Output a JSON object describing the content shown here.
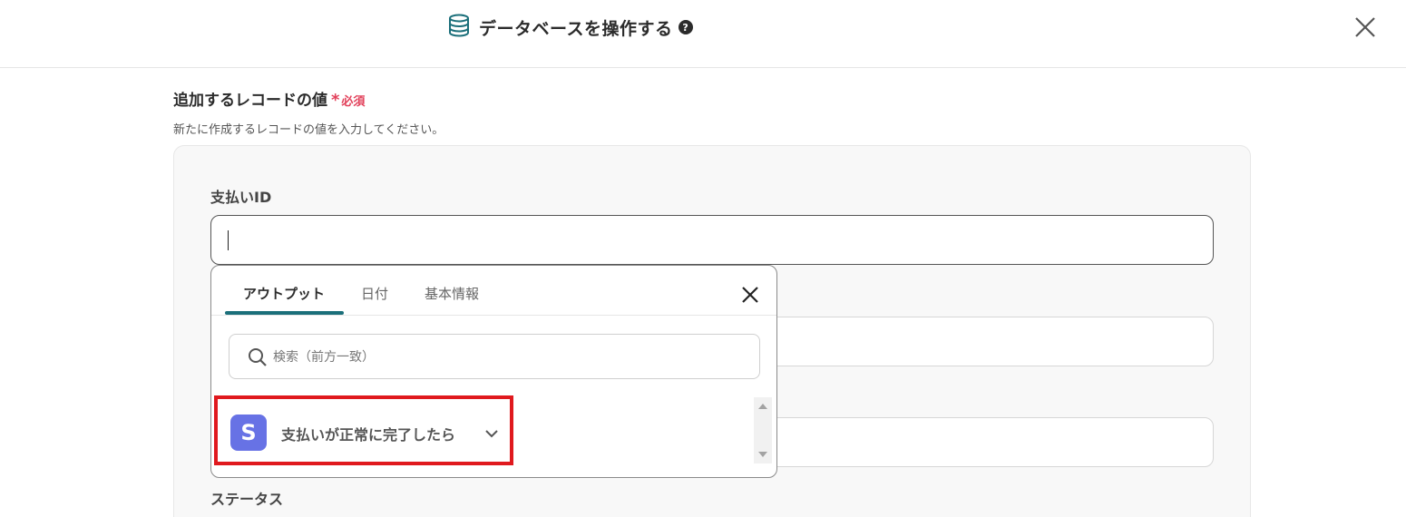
{
  "header": {
    "title": "データベースを操作する",
    "help_symbol": "?",
    "icons": {
      "database": "database-icon",
      "help": "help-icon",
      "close": "close-icon"
    }
  },
  "section": {
    "title": "追加するレコードの値",
    "required_star": "*",
    "required_label": "必須",
    "description": "新たに作成するレコードの値を入力してください。"
  },
  "fields": {
    "payment_id_label": "支払いID",
    "status_label": "ステータス"
  },
  "dropdown": {
    "tabs": [
      {
        "label": "アウトプット",
        "active": true
      },
      {
        "label": "日付",
        "active": false
      },
      {
        "label": "基本情報",
        "active": false
      }
    ],
    "search_placeholder": "検索（前方一致）",
    "result": {
      "logo_letter": "S",
      "label": "支払いが正常に完了したら"
    }
  },
  "colors": {
    "accent": "#1b6f7a",
    "required": "#e2405a",
    "highlight": "#e0191e",
    "stripe": "#6772e5"
  }
}
